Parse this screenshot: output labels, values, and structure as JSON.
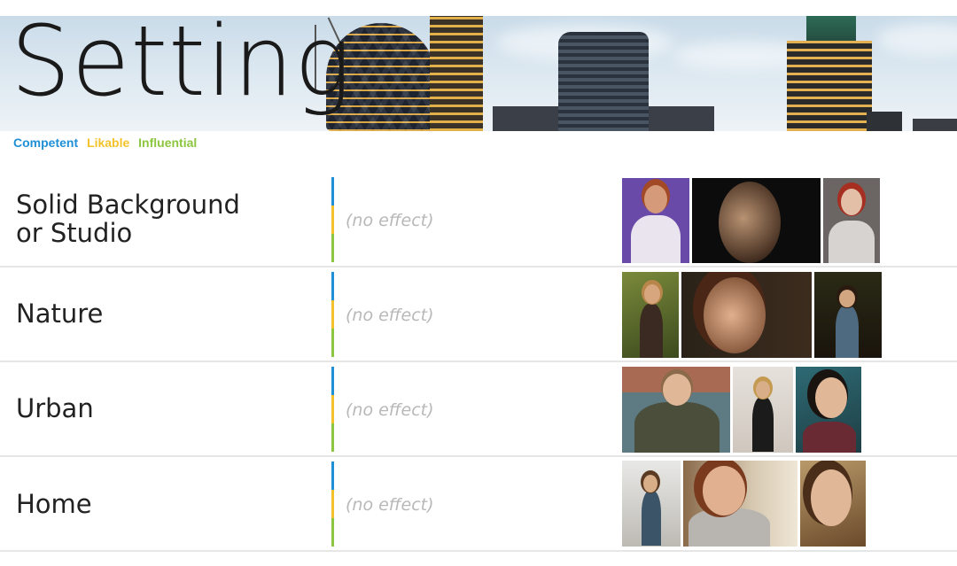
{
  "header": {
    "title": "Setting",
    "legend": [
      {
        "label": "Competent",
        "color": "#1f8fd6"
      },
      {
        "label": "Likable",
        "color": "#f3c22a"
      },
      {
        "label": "Influential",
        "color": "#8cc63f"
      }
    ]
  },
  "rows": [
    {
      "label_line1": "Solid Background",
      "label_line2": "or Studio",
      "effect": "(no effect)",
      "photo_names": [
        "studio-photo-woman-purple",
        "studio-photo-man-profile",
        "studio-photo-woman-redhead"
      ]
    },
    {
      "label_line1": "Nature",
      "label_line2": "",
      "effect": "(no effect)",
      "photo_names": [
        "nature-photo-woman-garden",
        "nature-photo-woman-closeup",
        "nature-photo-woman-trees"
      ]
    },
    {
      "label_line1": "Urban",
      "label_line2": "",
      "effect": "(no effect)",
      "photo_names": [
        "urban-photo-man-cards",
        "urban-photo-woman-dress",
        "urban-photo-woman-smiling"
      ]
    },
    {
      "label_line1": "Home",
      "label_line2": "",
      "effect": "(no effect)",
      "photo_names": [
        "home-photo-woman-stairs",
        "home-photo-woman-sweater",
        "home-photo-woman-smile"
      ]
    }
  ],
  "colors": {
    "competent": "#1f8fd6",
    "likable": "#f3c22a",
    "influential": "#8cc63f",
    "effect_text": "#b8b8b8",
    "row_border": "#e6e6e6"
  }
}
